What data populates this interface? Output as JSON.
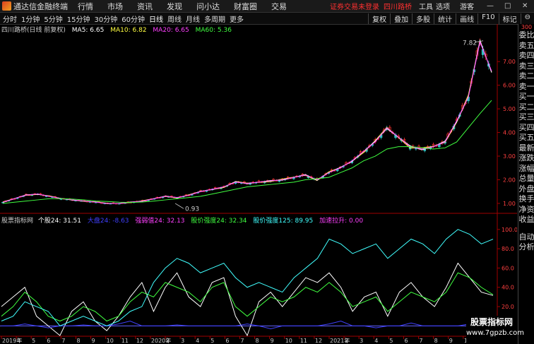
{
  "app": {
    "name": "通达信金融终端",
    "menus": [
      "行情",
      "市场",
      "资讯",
      "发现",
      "问小达",
      "财富圈",
      "交易"
    ],
    "login": "证券交易未登录",
    "stock": "四川路桥",
    "tools": "工具",
    "options": "选项",
    "guest": "游客"
  },
  "periods": [
    "分时",
    "1分钟",
    "5分钟",
    "15分钟",
    "30分钟",
    "60分钟",
    "日线",
    "周线",
    "月线",
    "多周期",
    "更多"
  ],
  "active_period": "日线",
  "right_buttons": [
    "复权",
    "叠加",
    "多股",
    "统计",
    "画线",
    "F10",
    "标记",
    "⊖"
  ],
  "legend1": {
    "title": "四川路桥(日线 前复权)",
    "items": [
      {
        "label": "MA5: 6.65",
        "color": "#ffffff"
      },
      {
        "label": "MA10: 6.82",
        "color": "#ffff40"
      },
      {
        "label": "MA20: 6.65",
        "color": "#ff40ff"
      },
      {
        "label": "MA60: 5.36",
        "color": "#40ff40"
      }
    ]
  },
  "legend2": {
    "title": "股票指标网",
    "items": [
      {
        "label": "个股24: 31.51",
        "color": "#ffffff"
      },
      {
        "label": "大盘24: -8.63",
        "color": "#4040ff"
      },
      {
        "label": "强弱值24: 32.13",
        "color": "#ff40ff"
      },
      {
        "label": "股价强度24: 32.34",
        "color": "#40ff40"
      },
      {
        "label": "股价强度125: 89.95",
        "color": "#40ffff"
      },
      {
        "label": "加速拉升: 0.00",
        "color": "#ff40ff"
      }
    ]
  },
  "price_axis": [
    "7.00",
    "6.00",
    "5.00",
    "4.00",
    "3.00",
    "2.00",
    "1.00"
  ],
  "indicator_axis": [
    "100.0",
    "80.0",
    "60.0",
    "40.0",
    "20.0",
    "0.00"
  ],
  "peak_label": "7.82",
  "low_label": "0.93",
  "x_axis": [
    "2019年",
    "4",
    "5",
    "6",
    "7",
    "8",
    "9",
    "10",
    "11",
    "12",
    "2020年",
    "2",
    "3",
    "4",
    "5",
    "6",
    "7",
    "8",
    "9",
    "10",
    "11",
    "12",
    "2021年",
    "2",
    "3",
    "4",
    "5",
    "6",
    "7",
    "8",
    "9",
    "10",
    "11"
  ],
  "side_items": [
    "委比",
    "卖五",
    "卖四",
    "卖三",
    "卖二",
    "卖一",
    "买一",
    "买二",
    "买三",
    "买四",
    "买五",
    "最新",
    "涨跌",
    "涨幅",
    "总量",
    "外盘",
    "换手",
    "净资",
    "收益"
  ],
  "side_top": "300",
  "side_bottom": [
    "自动",
    "分析",
    "+自选"
  ],
  "watermark": {
    "line1": "股票指标网",
    "line2": "www.7gpzb.com"
  },
  "chart_data": [
    {
      "type": "line",
      "title": "四川路桥(日线 前复权)",
      "ylim": [
        0.7,
        8.2
      ],
      "price": [
        1.05,
        1.2,
        1.35,
        1.4,
        1.3,
        1.2,
        1.15,
        1.1,
        1.05,
        1.0,
        1.0,
        1.05,
        1.1,
        1.2,
        1.3,
        1.25,
        1.35,
        1.5,
        1.6,
        1.7,
        1.9,
        1.85,
        1.9,
        1.95,
        2.0,
        2.1,
        2.2,
        2.0,
        2.3,
        2.5,
        2.8,
        3.2,
        3.6,
        4.2,
        3.8,
        3.4,
        3.3,
        3.4,
        3.6,
        4.5,
        5.5,
        7.82,
        6.6
      ],
      "ma60": [
        1.0,
        1.05,
        1.1,
        1.15,
        1.2,
        1.2,
        1.18,
        1.15,
        1.1,
        1.08,
        1.05,
        1.04,
        1.06,
        1.1,
        1.15,
        1.2,
        1.25,
        1.3,
        1.4,
        1.5,
        1.6,
        1.7,
        1.75,
        1.8,
        1.85,
        1.9,
        2.0,
        2.05,
        2.1,
        2.3,
        2.5,
        2.8,
        3.0,
        3.3,
        3.4,
        3.4,
        3.35,
        3.3,
        3.35,
        3.6,
        4.2,
        4.8,
        5.36
      ]
    },
    {
      "type": "line",
      "title": "股票指标网",
      "ylim": [
        -10,
        105
      ],
      "series": [
        {
          "name": "个股24",
          "color": "#ffffff",
          "values": [
            20,
            30,
            40,
            10,
            0,
            -10,
            15,
            25,
            5,
            -5,
            10,
            30,
            45,
            15,
            40,
            55,
            30,
            20,
            45,
            50,
            10,
            -10,
            25,
            35,
            20,
            35,
            50,
            45,
            55,
            40,
            15,
            30,
            35,
            10,
            35,
            45,
            30,
            20,
            40,
            65,
            50,
            35,
            31.51
          ]
        },
        {
          "name": "大盘24",
          "color": "#4040ff",
          "values": [
            0,
            0,
            2,
            0,
            -2,
            0,
            0,
            1,
            0,
            0,
            2,
            5,
            0,
            0,
            0,
            1,
            0,
            0,
            0,
            0,
            0,
            2,
            0,
            -3,
            0,
            0,
            0,
            0,
            2,
            5,
            0,
            0,
            -2,
            0,
            0,
            3,
            0,
            0,
            0,
            0,
            2,
            0,
            -8.63
          ]
        },
        {
          "name": "股价强度24",
          "color": "#40ff40",
          "values": [
            10,
            20,
            35,
            25,
            10,
            5,
            10,
            20,
            15,
            5,
            10,
            25,
            35,
            30,
            45,
            40,
            35,
            25,
            40,
            45,
            20,
            10,
            20,
            30,
            25,
            30,
            40,
            35,
            45,
            35,
            20,
            25,
            30,
            15,
            25,
            35,
            30,
            25,
            35,
            55,
            50,
            40,
            32.34
          ]
        },
        {
          "name": "股价强度125",
          "color": "#40ffff",
          "values": [
            5,
            10,
            25,
            20,
            15,
            0,
            5,
            10,
            5,
            0,
            5,
            15,
            20,
            45,
            60,
            70,
            65,
            55,
            60,
            65,
            50,
            40,
            45,
            40,
            35,
            50,
            60,
            70,
            90,
            85,
            75,
            80,
            85,
            70,
            80,
            90,
            85,
            75,
            90,
            100,
            95,
            85,
            89.95
          ]
        }
      ]
    }
  ]
}
